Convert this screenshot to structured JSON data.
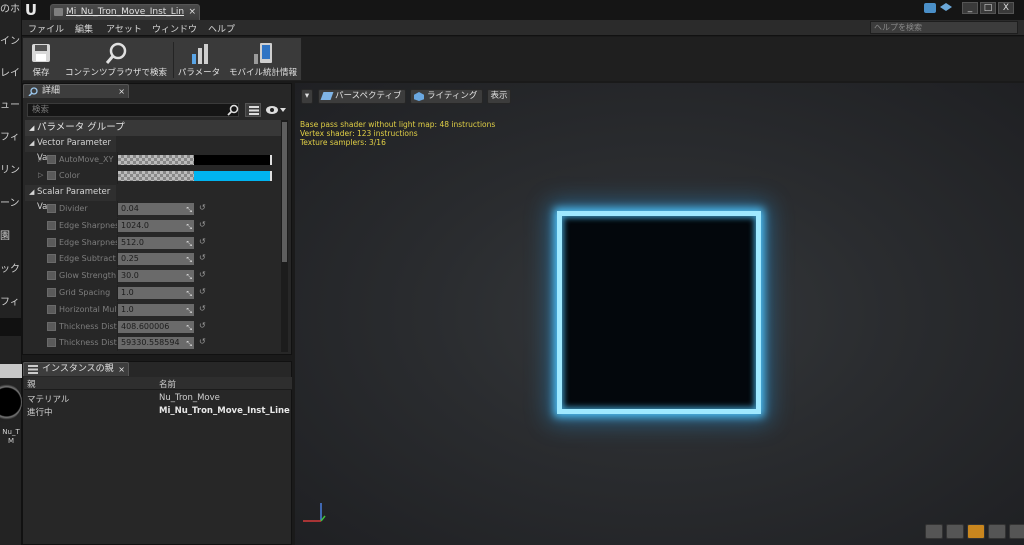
{
  "left_strip": {
    "items": [
      "のホ",
      "イン",
      "レイ",
      "ュー",
      "フィ",
      "リン",
      "ーン",
      "園",
      "ック",
      "フィ",
      "Nu_T",
      "M"
    ]
  },
  "titlebar": {
    "document_tab": "Mi_Nu_Tron_Move_Inst_Lin",
    "tab_close": "×",
    "logo": "U",
    "minimize": "_",
    "maximize": "□",
    "close": "X"
  },
  "menu": {
    "items": [
      "ファイル",
      "編集",
      "アセット",
      "ウィンドウ",
      "ヘルプ"
    ],
    "help_search_placeholder": "ヘルプを検索"
  },
  "toolbar": {
    "buttons": [
      {
        "label": "保存",
        "icon": "save-icon"
      },
      {
        "label": "コンテンツブラウザで検索",
        "icon": "magnifier-icon"
      },
      {
        "label": "パラメータ",
        "icon": "parameter-icon"
      },
      {
        "label": "モバイル統計情報",
        "icon": "mobile-stats-icon"
      }
    ]
  },
  "details": {
    "tab_label": "詳細",
    "tab_close": "×",
    "search_placeholder": "検索",
    "group_header": "パラメータ グループ",
    "vector_section": "Vector Parameter Va",
    "scalar_section": "Scalar Parameter Va",
    "vector_params": [
      {
        "name": "AutoMove_XY",
        "color": "#000000"
      },
      {
        "name": "Color",
        "color": "#00b4f0"
      }
    ],
    "scalar_params": [
      {
        "name": "Divider",
        "value": "0.04"
      },
      {
        "name": "Edge Sharpness",
        "value": "1024.0"
      },
      {
        "name": "Edge Sharpness",
        "value": "512.0"
      },
      {
        "name": "Edge Subtract",
        "value": "0.25"
      },
      {
        "name": "Glow Strength",
        "value": "30.0"
      },
      {
        "name": "Grid Spacing",
        "value": "1.0"
      },
      {
        "name": "Horizontal Multi",
        "value": "1.0"
      },
      {
        "name": "Thickness Dista",
        "value": "408.600006"
      },
      {
        "name": "Thickness Dista",
        "value": "59330.558594"
      }
    ]
  },
  "instance_parents": {
    "tab_label": "インスタンスの親",
    "tab_close": "×",
    "columns": [
      "親",
      "名前"
    ],
    "rows": [
      {
        "parent": "マテリアル",
        "name": "Nu_Tron_Move"
      },
      {
        "parent": "進行中",
        "name": "Mi_Nu_Tron_Move_Inst_Line"
      }
    ]
  },
  "viewport": {
    "perspective_button": "パースペクティブ",
    "lighting_button": "ライティング",
    "show_button": "表示",
    "stats": [
      "Base pass shader without light map: 48 instructions",
      "Vertex shader: 123 instructions",
      "Texture samplers: 3/16"
    ],
    "glow_color": "#9fe9ff"
  }
}
